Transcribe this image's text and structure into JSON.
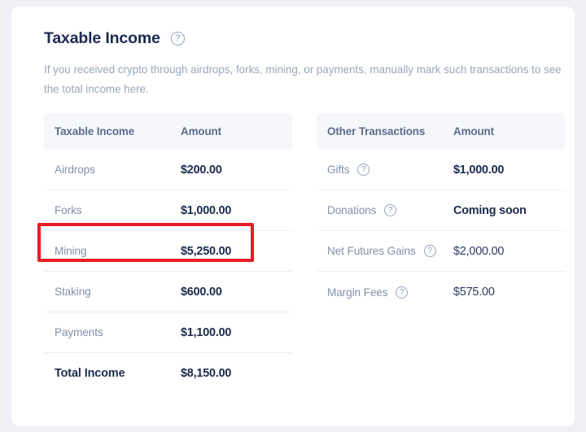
{
  "page": {
    "title": "Taxable Income",
    "title_help_icon": "question-mark-circle-icon",
    "description": "If you received crypto through airdrops, forks, mining, or payments, manually mark such transactions to see the total income here."
  },
  "income_table": {
    "headers": [
      "Taxable Income",
      "Amount"
    ],
    "rows": [
      {
        "label": "Airdrops",
        "amount": "$200.00",
        "bold": true,
        "help": false
      },
      {
        "label": "Forks",
        "amount": "$1,000.00",
        "bold": true,
        "help": false
      },
      {
        "label": "Mining",
        "amount": "$5,250.00",
        "bold": true,
        "help": false
      },
      {
        "label": "Staking",
        "amount": "$600.00",
        "bold": true,
        "help": false
      },
      {
        "label": "Payments",
        "amount": "$1,100.00",
        "bold": true,
        "help": false
      }
    ],
    "total": {
      "label": "Total Income",
      "amount": "$8,150.00"
    }
  },
  "other_table": {
    "headers": [
      "Other Transactions",
      "Amount"
    ],
    "rows": [
      {
        "label": "Gifts",
        "amount": "$1,000.00",
        "bold": true,
        "help": true
      },
      {
        "label": "Donations",
        "amount": "Coming soon",
        "bold": true,
        "help": true
      },
      {
        "label": "Net Futures Gains",
        "amount": "$2,000.00",
        "bold": false,
        "help": true
      },
      {
        "label": "Margin Fees",
        "amount": "$575.00",
        "bold": false,
        "help": true
      }
    ]
  },
  "annotation": {
    "highlight_target": "Mining",
    "highlight_color": "#e81c24"
  },
  "colors": {
    "page_background": "#eef0f6",
    "card_background": "#ffffff",
    "heading_text": "#1b2a4e",
    "muted_text": "#9aa7bd",
    "table_header_background": "#f5f7fb",
    "table_header_text": "#5c6c8a",
    "divider": "#edf0f5"
  }
}
